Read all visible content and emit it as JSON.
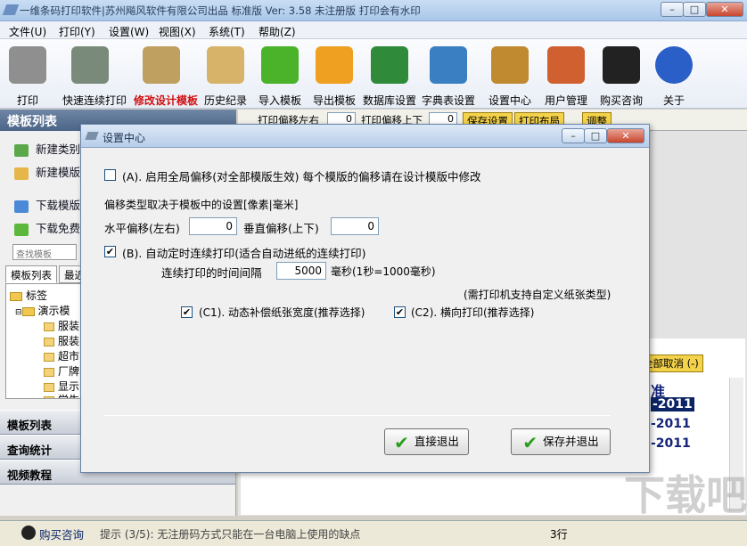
{
  "window": {
    "title": "一维条码打印软件|苏州飚风软件有限公司出品  标准版  Ver: 3.58  未注册版 打印会有水印",
    "minimize": "–",
    "maximize": "□",
    "close": "✕"
  },
  "menu": [
    "文件(U)",
    "打印(Y)",
    "设置(W)",
    "视图(X)",
    "系统(T)",
    "帮助(Z)"
  ],
  "toolbar": [
    {
      "label": "打印",
      "icon": "printer-icon",
      "color": "#8f8f8f"
    },
    {
      "label": "快速连续打印",
      "icon": "fast-print-icon",
      "color": "#7a8a7a"
    },
    {
      "label": "修改设计模板",
      "icon": "design-tools-icon",
      "color": "#c0a060",
      "highlight": true
    },
    {
      "label": "历史纪录",
      "icon": "clipboard-icon",
      "color": "#d7b36a"
    },
    {
      "label": "导入模板",
      "icon": "arrow-right-icon",
      "color": "#4ab32a"
    },
    {
      "label": "导出模板",
      "icon": "arrow-left-icon",
      "color": "#f0a020"
    },
    {
      "label": "数据库设置",
      "icon": "excel-icon",
      "color": "#2f8b3a"
    },
    {
      "label": "字典表设置",
      "icon": "address-book-icon",
      "color": "#3a7fc2"
    },
    {
      "label": "设置中心",
      "icon": "wrench-screwdriver-icon",
      "color": "#c08a30"
    },
    {
      "label": "用户管理",
      "icon": "users-icon",
      "color": "#d06030"
    },
    {
      "label": "购买咨询",
      "icon": "qq-penguin-icon",
      "color": "#222222"
    },
    {
      "label": "关于",
      "icon": "info-icon",
      "color": "#2a5fc8"
    }
  ],
  "left": {
    "header": "模板列表",
    "links": [
      "新建类别",
      "新建模版",
      "下载模版",
      "下载免费"
    ],
    "search_placeholder": "查找模板",
    "tabs": [
      "模板列表",
      "最近"
    ],
    "tree": {
      "root": "标签",
      "child": "演示模",
      "leaves": [
        "服装",
        "服装",
        "超市",
        "厂牌",
        "显示",
        "学生"
      ]
    },
    "nav": [
      "模板列表",
      "查询统计",
      "视频教程"
    ]
  },
  "right": {
    "strip": {
      "offset_lr_label": "打印偏移左右",
      "offset_lr_value": "0",
      "offset_ud_label": "打印偏移上下",
      "offset_ud_value": "0",
      "save_settings": "保存设置",
      "print_layout": "打印布局",
      "adjust": "调整"
    },
    "cancel_all": "全部取消 (-)",
    "list_header": "准",
    "rows": [
      "-2011",
      "-2011",
      "-2011"
    ]
  },
  "status": {
    "buy_label": "购买咨询",
    "tip": "提示 (3/5): 无注册码方式只能在一台电脑上使用的缺点",
    "rows": "3行"
  },
  "dialog": {
    "title": "设置中心",
    "option_a_checked": false,
    "option_a": "(A). 启用全局偏移(对全部模版生效)    每个模版的偏移请在设计模版中修改",
    "offset_type_note": "偏移类型取决于模板中的设置[像素|毫米]",
    "h_offset_label": "水平偏移(左右)",
    "h_offset_value": "0",
    "v_offset_label": "垂直偏移(上下)",
    "v_offset_value": "0",
    "option_b_checked": true,
    "option_b": "(B). 自动定时连续打印(适合自动进纸的连续打印)",
    "interval_label": "连续打印的时间间隔",
    "interval_value": "5000",
    "interval_unit": "毫秒(1秒=1000毫秒)",
    "printer_note": "(需打印机支持自定义纸张类型)",
    "option_c1_checked": true,
    "option_c1": "(C1). 动态补偿纸张宽度(推荐选择)",
    "option_c2_checked": true,
    "option_c2": "(C2). 横向打印(推荐选择)",
    "exit_button": "直接退出",
    "save_exit_button": "保存并退出"
  },
  "watermark": "下载吧"
}
